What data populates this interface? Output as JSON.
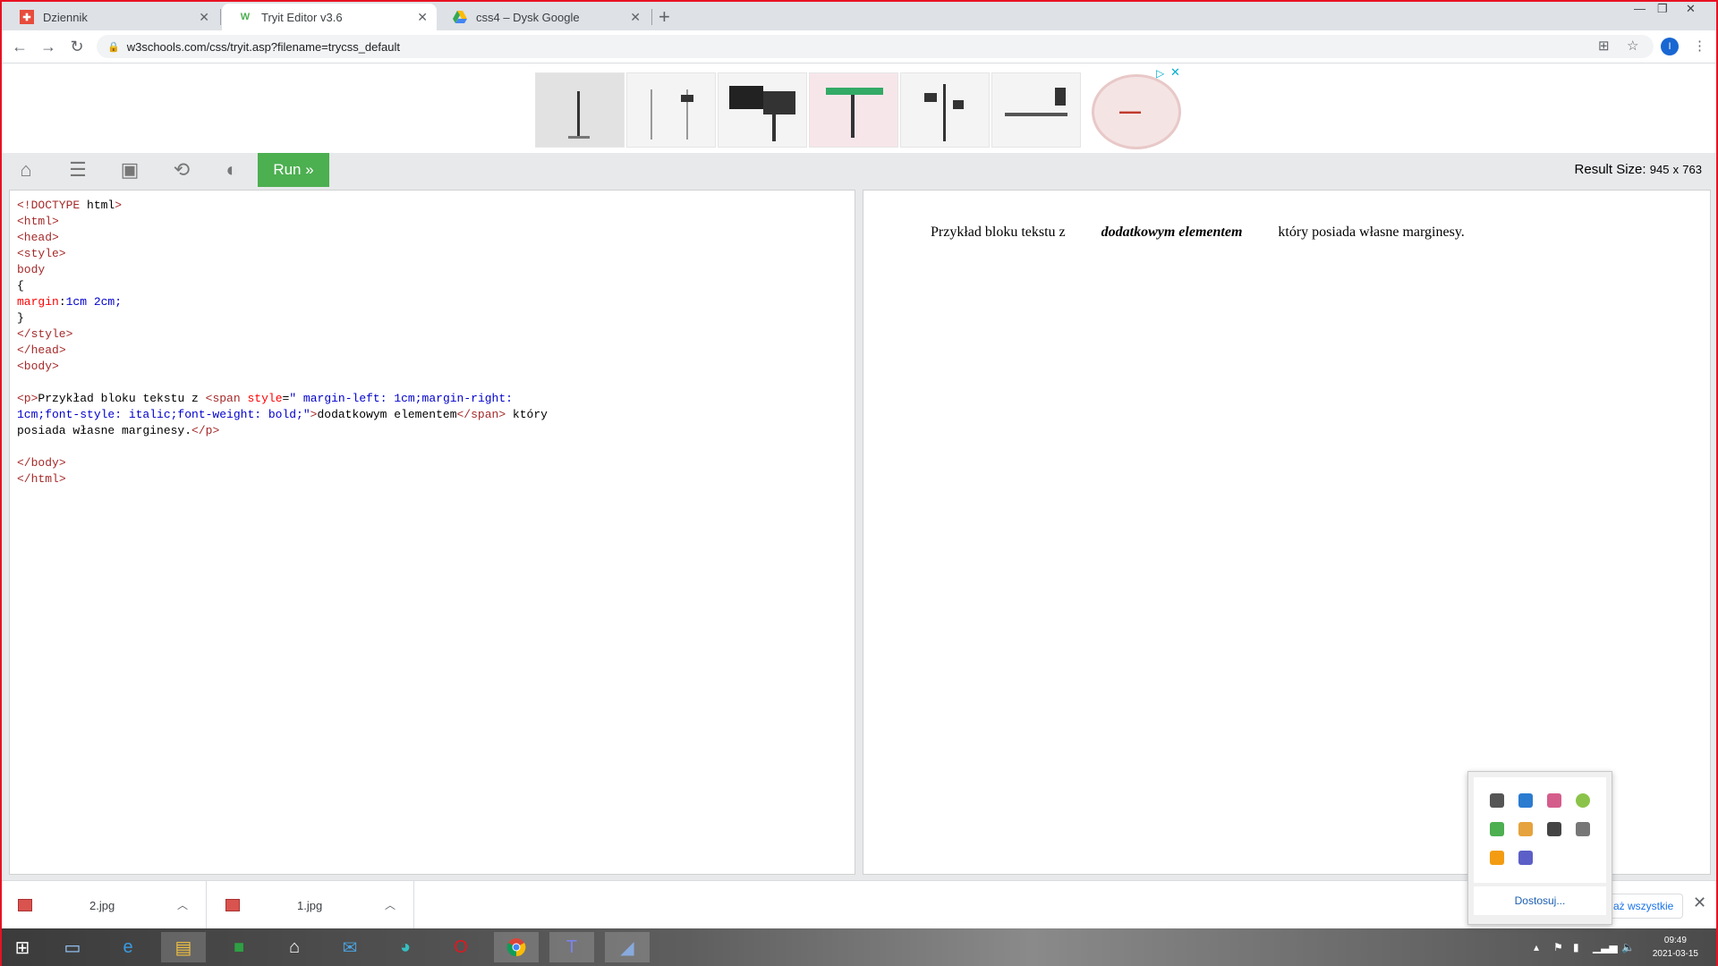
{
  "browser": {
    "tabs": [
      {
        "title": "Dziennik",
        "active": false
      },
      {
        "title": "Tryit Editor v3.6",
        "active": true
      },
      {
        "title": "css4 – Dysk Google",
        "active": false
      }
    ],
    "url": "w3schools.com/css/tryit.asp?filename=trycss_default",
    "profile_initial": "I"
  },
  "editor": {
    "run_label": "Run »",
    "result_size_label": "Result Size:",
    "result_width": "945",
    "result_x": "x",
    "result_height": "763",
    "code_lines": [
      "<!DOCTYPE html>",
      "<html>",
      "<head>",
      "<style>",
      "body",
      "{",
      "margin:1cm 2cm;",
      "}",
      "</style>",
      "</head>",
      "<body>",
      "",
      "<p>Przykład bloku tekstu z <span style=\" margin-left: 1cm;margin-right:",
      "1cm;font-style: italic;font-weight: bold;\">dodatkowym elementem</span> który",
      "posiada własne marginesy.</p>",
      "",
      "</body>",
      "</html>"
    ]
  },
  "result": {
    "text_before": "Przykład bloku tekstu z",
    "text_emphasis": "dodatkowym elementem",
    "text_after": "który posiada własne marginesy."
  },
  "tray_popup": {
    "customize_label": "Dostosuj..."
  },
  "downloads": {
    "items": [
      {
        "name": "2.jpg"
      },
      {
        "name": "1.jpg"
      }
    ],
    "show_all_label": "aż wszystkie"
  },
  "taskbar": {
    "time": "09:49",
    "date": "2021-03-15"
  }
}
